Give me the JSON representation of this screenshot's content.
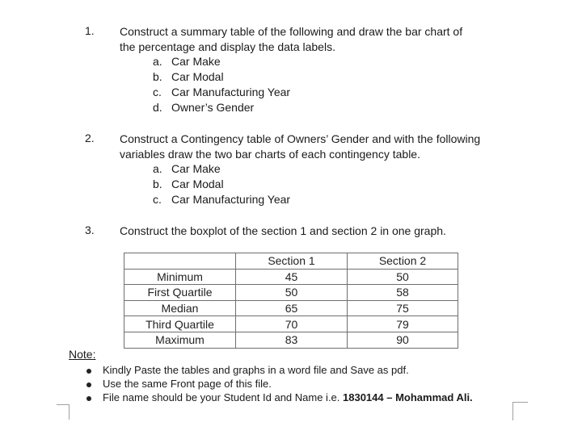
{
  "questions": [
    {
      "number": "1.",
      "lines": [
        "Construct a summary table of the following and draw the bar chart of",
        "the percentage and display the data labels."
      ],
      "items": [
        {
          "label": "a.",
          "text": "Car Make"
        },
        {
          "label": "b.",
          "text": "Car Modal"
        },
        {
          "label": "c.",
          "text": "Car Manufacturing Year"
        },
        {
          "label": "d.",
          "text": "Owner’s Gender"
        }
      ]
    },
    {
      "number": "2.",
      "lines": [
        "Construct a Contingency table of Owners’ Gender and with the following",
        "variables draw the two bar charts of each contingency table."
      ],
      "items": [
        {
          "label": "a.",
          "text": "Car Make"
        },
        {
          "label": "b.",
          "text": "Car Modal"
        },
        {
          "label": "c.",
          "text": "Car Manufacturing Year"
        }
      ]
    },
    {
      "number": "3.",
      "lines": [
        "Construct the boxplot of the section 1 and section 2 in one graph."
      ],
      "items": []
    }
  ],
  "stats_table": {
    "headers": [
      "",
      "Section 1",
      "Section 2"
    ],
    "rows": [
      [
        "Minimum",
        "45",
        "50"
      ],
      [
        "First Quartile",
        "50",
        "58"
      ],
      [
        "Median",
        "65",
        "75"
      ],
      [
        "Third Quartile",
        "70",
        "79"
      ],
      [
        "Maximum",
        "83",
        "90"
      ]
    ]
  },
  "note": {
    "heading": "Note:",
    "bullets": [
      {
        "text": "Kindly Paste the tables and graphs in a word file and Save as pdf.",
        "bold": ""
      },
      {
        "text": "Use the same Front page of this file.",
        "bold": ""
      },
      {
        "text": "File name should be your Student Id and Name i.e. ",
        "bold": "1830144 – Mohammad Ali."
      }
    ]
  }
}
